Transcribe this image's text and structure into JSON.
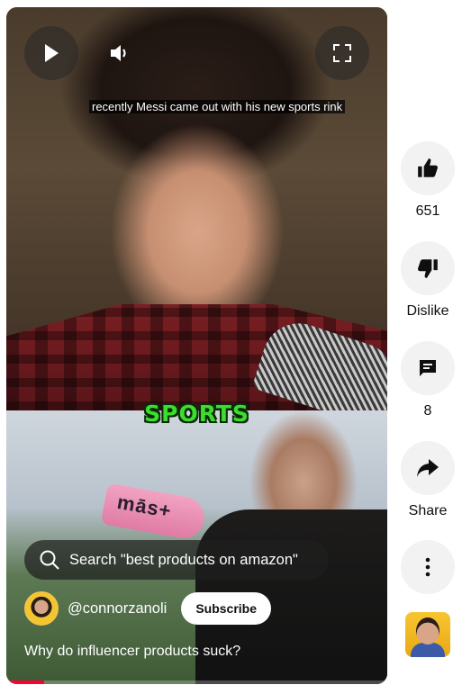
{
  "video": {
    "caption": "recently Messi came out with his new sports rink",
    "overlay_word": "SPORTS",
    "product_text": "mās+",
    "search_text": "Search \"best products on amazon\"",
    "channel_handle": "@connorzanoli",
    "subscribe_label": "Subscribe",
    "title": "Why do influencer products suck?",
    "progress_fraction": 0.1
  },
  "controls": {
    "play_icon": "play-icon",
    "volume_icon": "volume-icon",
    "fullscreen_icon": "fullscreen-icon"
  },
  "actions": {
    "like_count": "651",
    "dislike_label": "Dislike",
    "comment_count": "8",
    "share_label": "Share"
  },
  "colors": {
    "accent_progress": "#ff0033",
    "overlay_word": "#3ddc2e",
    "action_bg": "#f2f2f2"
  }
}
